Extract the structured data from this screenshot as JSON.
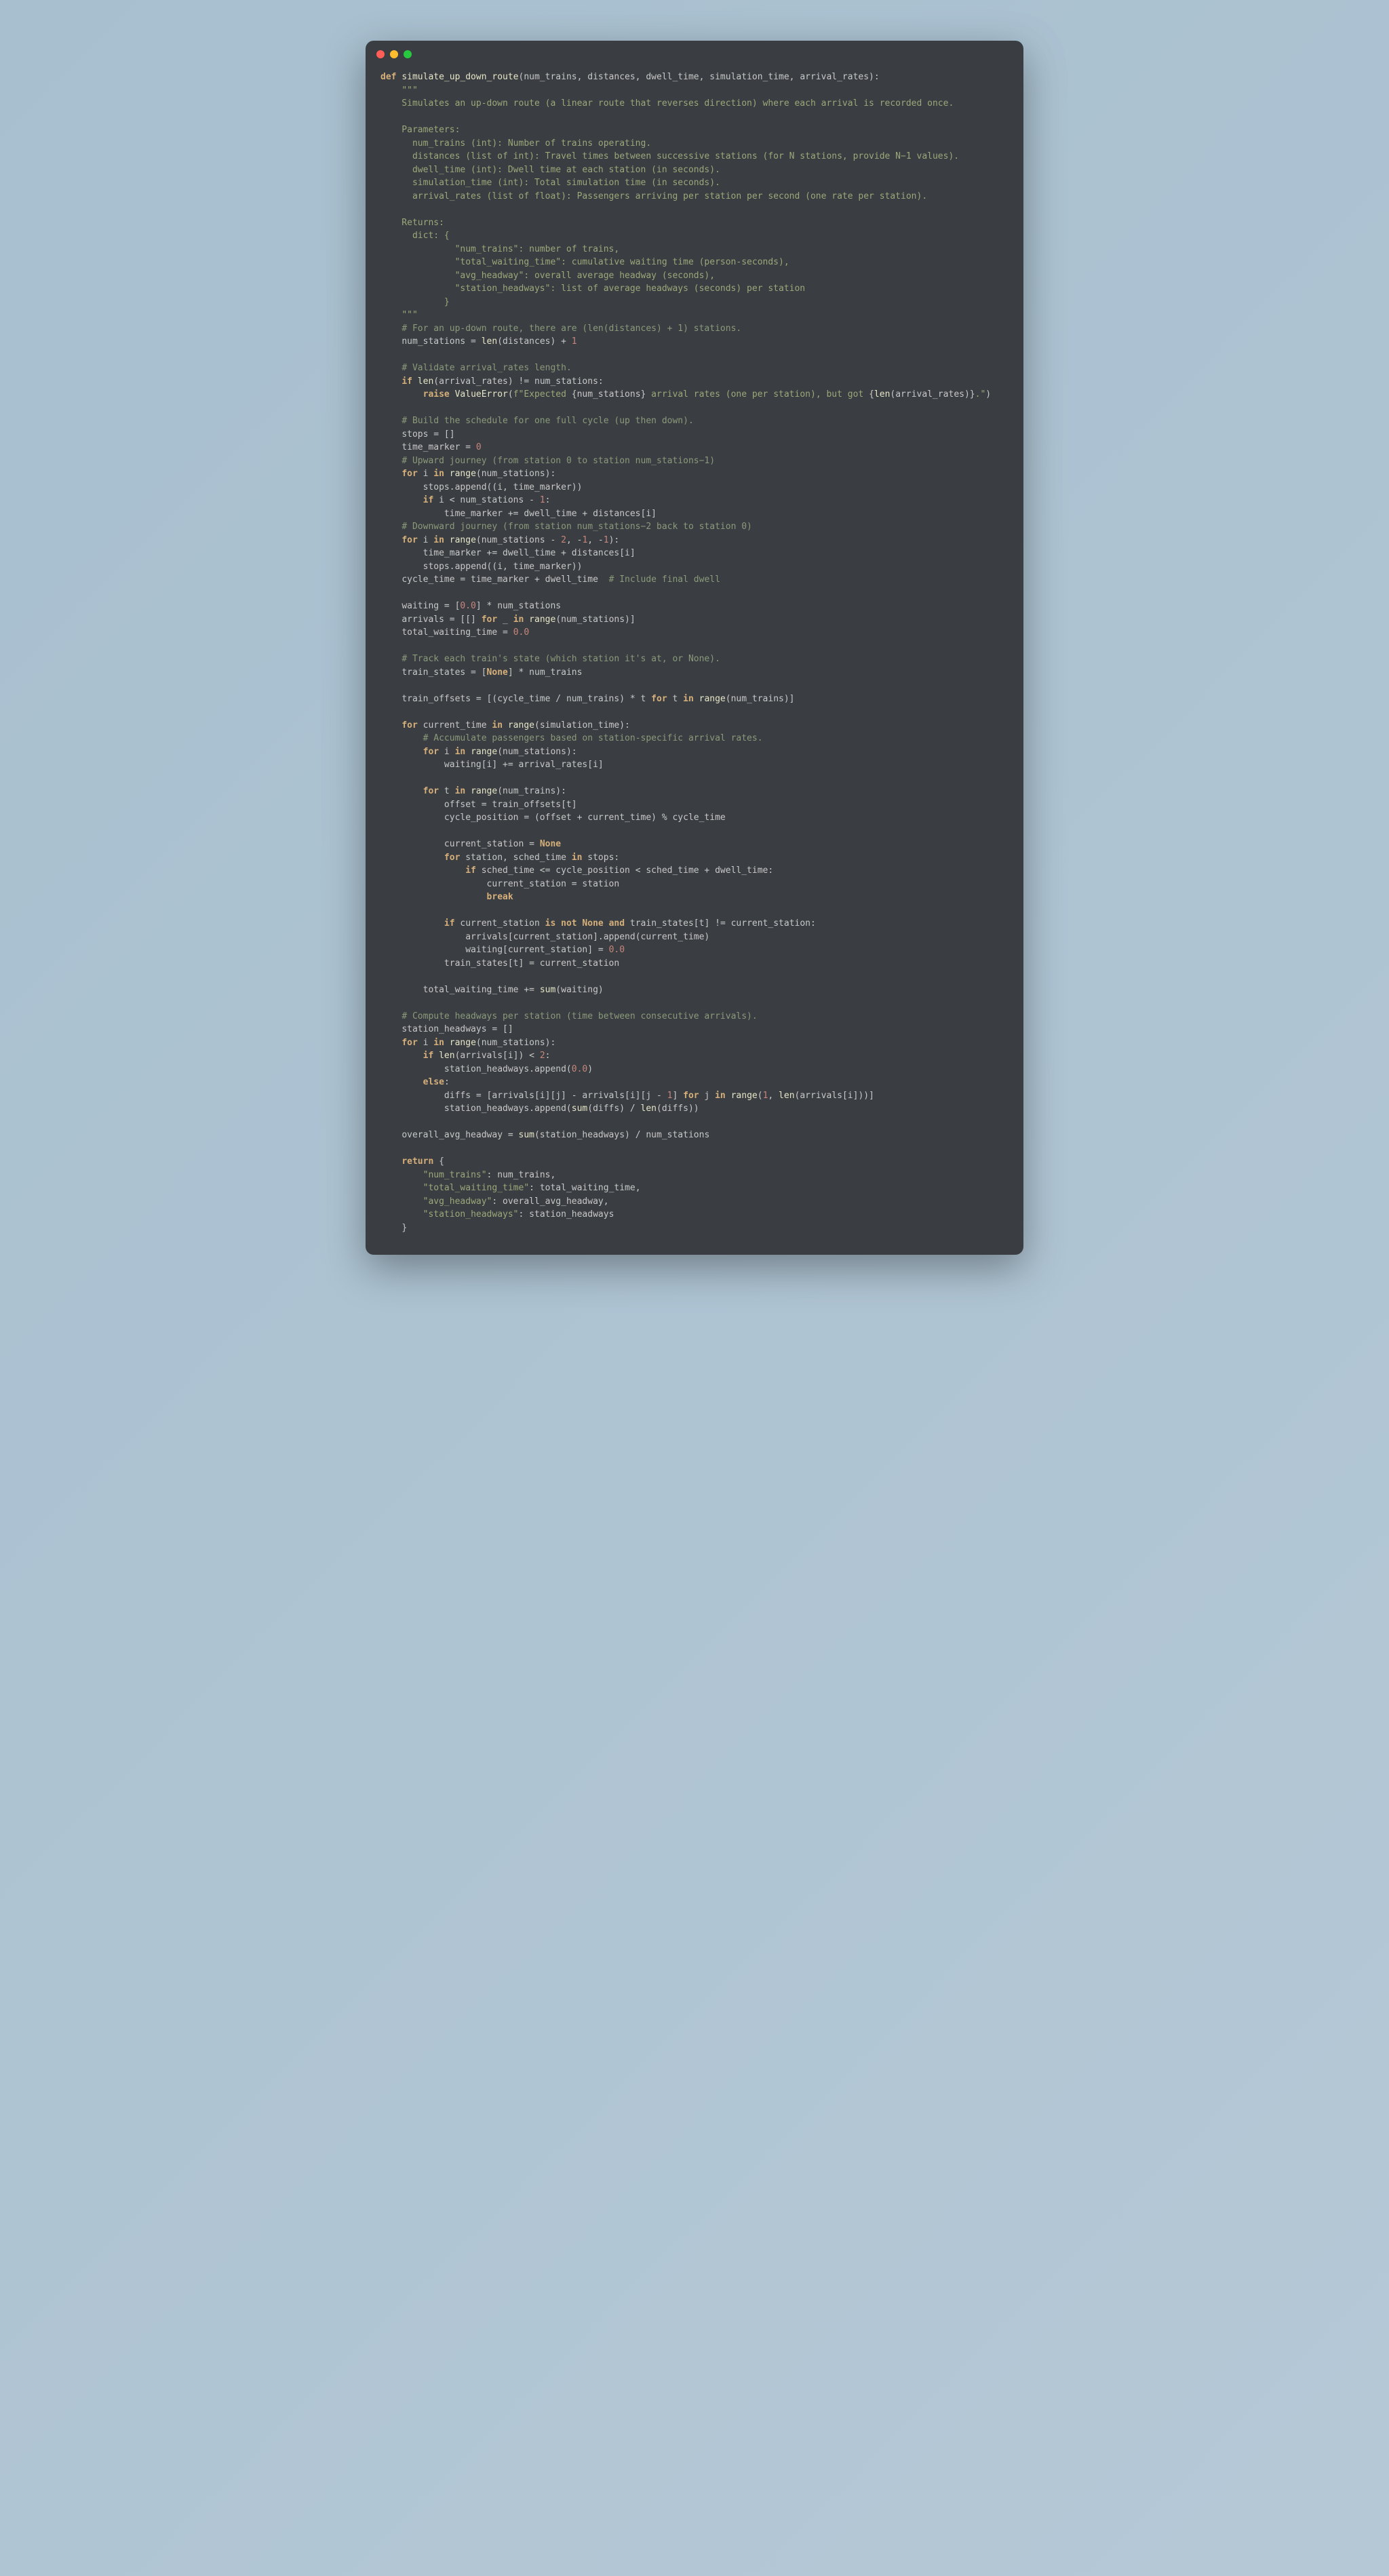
{
  "window": {
    "dots": [
      "red",
      "yellow",
      "green"
    ]
  },
  "code": {
    "docstring_open": "\"\"\"",
    "docstring_close": "\"\"\"",
    "lines": {
      "l0_def": "def",
      "l0_name": "simulate_up_down_route",
      "l0_params": "(num_trains, distances, dwell_time, simulation_time, arrival_rates):",
      "doc1": "    Simulates an up-down route (a linear route that reverses direction) where each arrival is recorded once.",
      "doc2": "    Parameters:",
      "doc3": "      num_trains (int): Number of trains operating.",
      "doc4": "      distances (list of int): Travel times between successive stations (for N stations, provide N−1 values).",
      "doc5": "      dwell_time (int): Dwell time at each station (in seconds).",
      "doc6": "      simulation_time (int): Total simulation time (in seconds).",
      "doc7": "      arrival_rates (list of float): Passengers arriving per station per second (one rate per station).",
      "doc8": "    Returns:",
      "doc9": "      dict: {",
      "doc10": "              \"num_trains\": number of trains,",
      "doc11": "              \"total_waiting_time\": cumulative waiting time (person-seconds),",
      "doc12": "              \"avg_headway\": overall average headway (seconds),",
      "doc13": "              \"station_headways\": list of average headways (seconds) per station",
      "doc14": "            }",
      "c1": "# For an up-down route, there are (len(distances) + 1) stations.",
      "s1a": "num_stations = ",
      "s1b": "len",
      "s1c": "(distances) + ",
      "s1d": "1",
      "c2": "# Validate arrival_rates length.",
      "s2a": "if",
      "s2b": " len",
      "s2c": "(arrival_rates) != num_stations:",
      "s3a": "raise",
      "s3b": " ValueError",
      "s3c": "(",
      "s3d": "f\"Expected ",
      "s3e": "{num_stations}",
      "s3f": " arrival rates (one per station), but got ",
      "s3g": "{",
      "s3h": "len",
      "s3i": "(arrival_rates)}",
      "s3j": ".\"",
      "s3k": ")",
      "c3": "# Build the schedule for one full cycle (up then down).",
      "s4": "stops = []",
      "s5a": "time_marker = ",
      "s5b": "0",
      "c4": "# Upward journey (from station 0 to station num_stations−1)",
      "s6a": "for",
      "s6b": " i ",
      "s6c": "in",
      "s6d": " range",
      "s6e": "(num_stations):",
      "s7": "stops.append((i, time_marker))",
      "s8a": "if",
      "s8b": " i < num_stations - ",
      "s8c": "1",
      "s8d": ":",
      "s9": "time_marker += dwell_time + distances[i]",
      "c5": "# Downward journey (from station num_stations−2 back to station 0)",
      "s10a": "for",
      "s10b": " i ",
      "s10c": "in",
      "s10d": " range",
      "s10e": "(num_stations - ",
      "s10f": "2",
      "s10g": ", -",
      "s10h": "1",
      "s10i": ", -",
      "s10j": "1",
      "s10k": "):",
      "s11": "time_marker += dwell_time + distances[i]",
      "s12": "stops.append((i, time_marker))",
      "s13a": "cycle_time = time_marker + dwell_time  ",
      "s13b": "# Include final dwell",
      "s14a": "waiting = [",
      "s14b": "0.0",
      "s14c": "] * num_stations",
      "s15a": "arrivals = [[] ",
      "s15b": "for",
      "s15c": " _ ",
      "s15d": "in",
      "s15e": " range",
      "s15f": "(num_stations)]",
      "s16a": "total_waiting_time = ",
      "s16b": "0.0",
      "c6": "# Track each train's state (which station it's at, or None).",
      "s17a": "train_states = [",
      "s17b": "None",
      "s17c": "] * num_trains",
      "s18a": "train_offsets = [(cycle_time / num_trains) * t ",
      "s18b": "for",
      "s18c": " t ",
      "s18d": "in",
      "s18e": " range",
      "s18f": "(num_trains)]",
      "s19a": "for",
      "s19b": " current_time ",
      "s19c": "in",
      "s19d": " range",
      "s19e": "(simulation_time):",
      "c7": "# Accumulate passengers based on station-specific arrival rates.",
      "s20a": "for",
      "s20b": " i ",
      "s20c": "in",
      "s20d": " range",
      "s20e": "(num_stations):",
      "s21": "waiting[i] += arrival_rates[i]",
      "s22a": "for",
      "s22b": " t ",
      "s22c": "in",
      "s22d": " range",
      "s22e": "(num_trains):",
      "s23": "offset = train_offsets[t]",
      "s24": "cycle_position = (offset + current_time) % cycle_time",
      "s25a": "current_station = ",
      "s25b": "None",
      "s26a": "for",
      "s26b": " station, sched_time ",
      "s26c": "in",
      "s26d": " stops:",
      "s27a": "if",
      "s27b": " sched_time <= cycle_position < sched_time + dwell_time:",
      "s28": "current_station = station",
      "s29": "break",
      "s30a": "if",
      "s30b": " current_station ",
      "s30c": "is not",
      "s30d": " None",
      "s30e": " and",
      "s30f": " train_states[t] != current_station:",
      "s31": "arrivals[current_station].append(current_time)",
      "s32a": "waiting[current_station] = ",
      "s32b": "0.0",
      "s33": "train_states[t] = current_station",
      "s34a": "total_waiting_time += ",
      "s34b": "sum",
      "s34c": "(waiting)",
      "c8": "# Compute headways per station (time between consecutive arrivals).",
      "s35": "station_headways = []",
      "s36a": "for",
      "s36b": " i ",
      "s36c": "in",
      "s36d": " range",
      "s36e": "(num_stations):",
      "s37a": "if",
      "s37b": " len",
      "s37c": "(arrivals[i]) < ",
      "s37d": "2",
      "s37e": ":",
      "s38a": "station_headways.append(",
      "s38b": "0.0",
      "s38c": ")",
      "s39": "else",
      "s40a": "diffs = [arrivals[i][j] - arrivals[i][j - ",
      "s40b": "1",
      "s40c": "] ",
      "s40d": "for",
      "s40e": " j ",
      "s40f": "in",
      "s40g": " range",
      "s40h": "(",
      "s40i": "1",
      "s40j": ", ",
      "s40k": "len",
      "s40l": "(arrivals[i]))]",
      "s41a": "station_headways.append(",
      "s41b": "sum",
      "s41c": "(diffs) / ",
      "s41d": "len",
      "s41e": "(diffs))",
      "s42a": "overall_avg_headway = ",
      "s42b": "sum",
      "s42c": "(station_headways) / num_stations",
      "s43": "return",
      "s44a": "\"num_trains\"",
      "s44b": ": num_trains,",
      "s45a": "\"total_waiting_time\"",
      "s45b": ": total_waiting_time,",
      "s46a": "\"avg_headway\"",
      "s46b": ": overall_avg_headway,",
      "s47a": "\"station_headways\"",
      "s47b": ": station_headways",
      "s48": "}"
    }
  }
}
